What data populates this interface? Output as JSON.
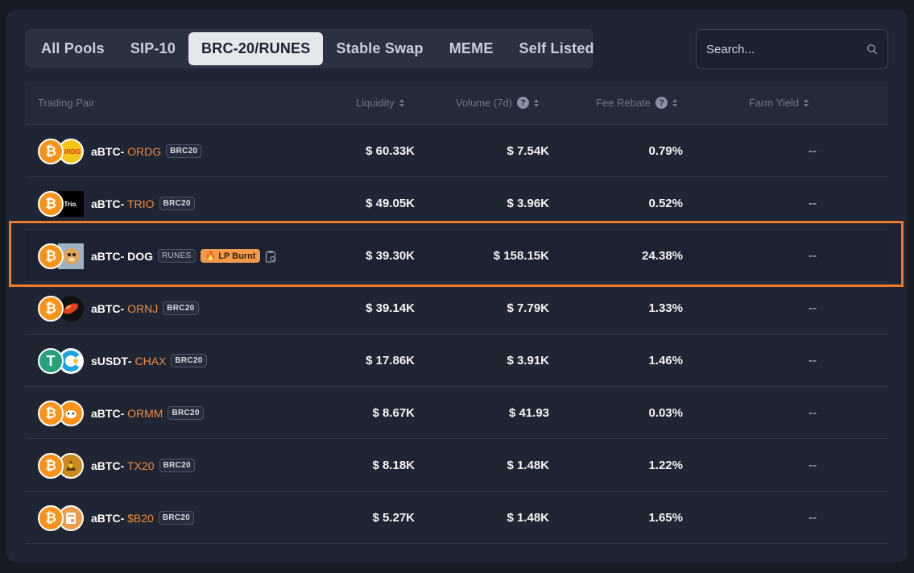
{
  "tabs": [
    {
      "label": "All Pools",
      "active": false
    },
    {
      "label": "SIP-10",
      "active": false
    },
    {
      "label": "BRC-20/RUNES",
      "active": true
    },
    {
      "label": "Stable Swap",
      "active": false
    },
    {
      "label": "MEME",
      "active": false
    },
    {
      "label": "Self Listed",
      "active": false
    }
  ],
  "search": {
    "placeholder": "Search...",
    "icon": "search-icon"
  },
  "columns": {
    "pair": "Trading Pair",
    "liquidity": "Liquidity",
    "volume": "Volume (7d)",
    "fee": "Fee Rebate",
    "farm": "Farm Yield"
  },
  "colors": {
    "accent": "#f2893d",
    "highlight": "#ec7a2b",
    "active_tab": "#e4e7ec"
  },
  "rows": [
    {
      "base": "aBTC",
      "sep": " - ",
      "quote": "ORDG",
      "badge": "BRC20",
      "liquidity": "$ 60.33K",
      "volume": "$ 7.54K",
      "fee": "0.79%",
      "farm": "--",
      "icon_b": "ORDG"
    },
    {
      "base": "aBTC",
      "sep": " - ",
      "quote": "TRIO",
      "badge": "BRC20",
      "liquidity": "$ 49.05K",
      "volume": "$ 3.96K",
      "fee": "0.52%",
      "farm": "--",
      "icon_b": "Trio."
    },
    {
      "base": "aBTC",
      "sep": " - ",
      "quote": "DOG",
      "badge": "RUNES",
      "lp": "LP Burnt",
      "liquidity": "$ 39.30K",
      "volume": "$ 158.15K",
      "fee": "24.38%",
      "farm": "--"
    },
    {
      "base": "aBTC",
      "sep": " - ",
      "quote": "ORNJ",
      "badge": "BRC20",
      "liquidity": "$ 39.14K",
      "volume": "$ 7.79K",
      "fee": "1.33%",
      "farm": "--"
    },
    {
      "base": "sUSDT",
      "sep": " - ",
      "quote": "CHAX",
      "badge": "BRC20",
      "liquidity": "$ 17.86K",
      "volume": "$ 3.91K",
      "fee": "1.46%",
      "farm": "--",
      "icon_a": "T"
    },
    {
      "base": "aBTC",
      "sep": " - ",
      "quote": "ORMM",
      "badge": "BRC20",
      "liquidity": "$ 8.67K",
      "volume": "$ 41.93",
      "fee": "0.03%",
      "farm": "--"
    },
    {
      "base": "aBTC",
      "sep": " - ",
      "quote": "TX20",
      "badge": "BRC20",
      "liquidity": "$ 8.18K",
      "volume": "$ 1.48K",
      "fee": "1.22%",
      "farm": "--"
    },
    {
      "base": "aBTC",
      "sep": " - ",
      "quote": "$B20",
      "badge": "BRC20",
      "liquidity": "$ 5.27K",
      "volume": "$ 1.48K",
      "fee": "1.65%",
      "farm": "--"
    }
  ]
}
